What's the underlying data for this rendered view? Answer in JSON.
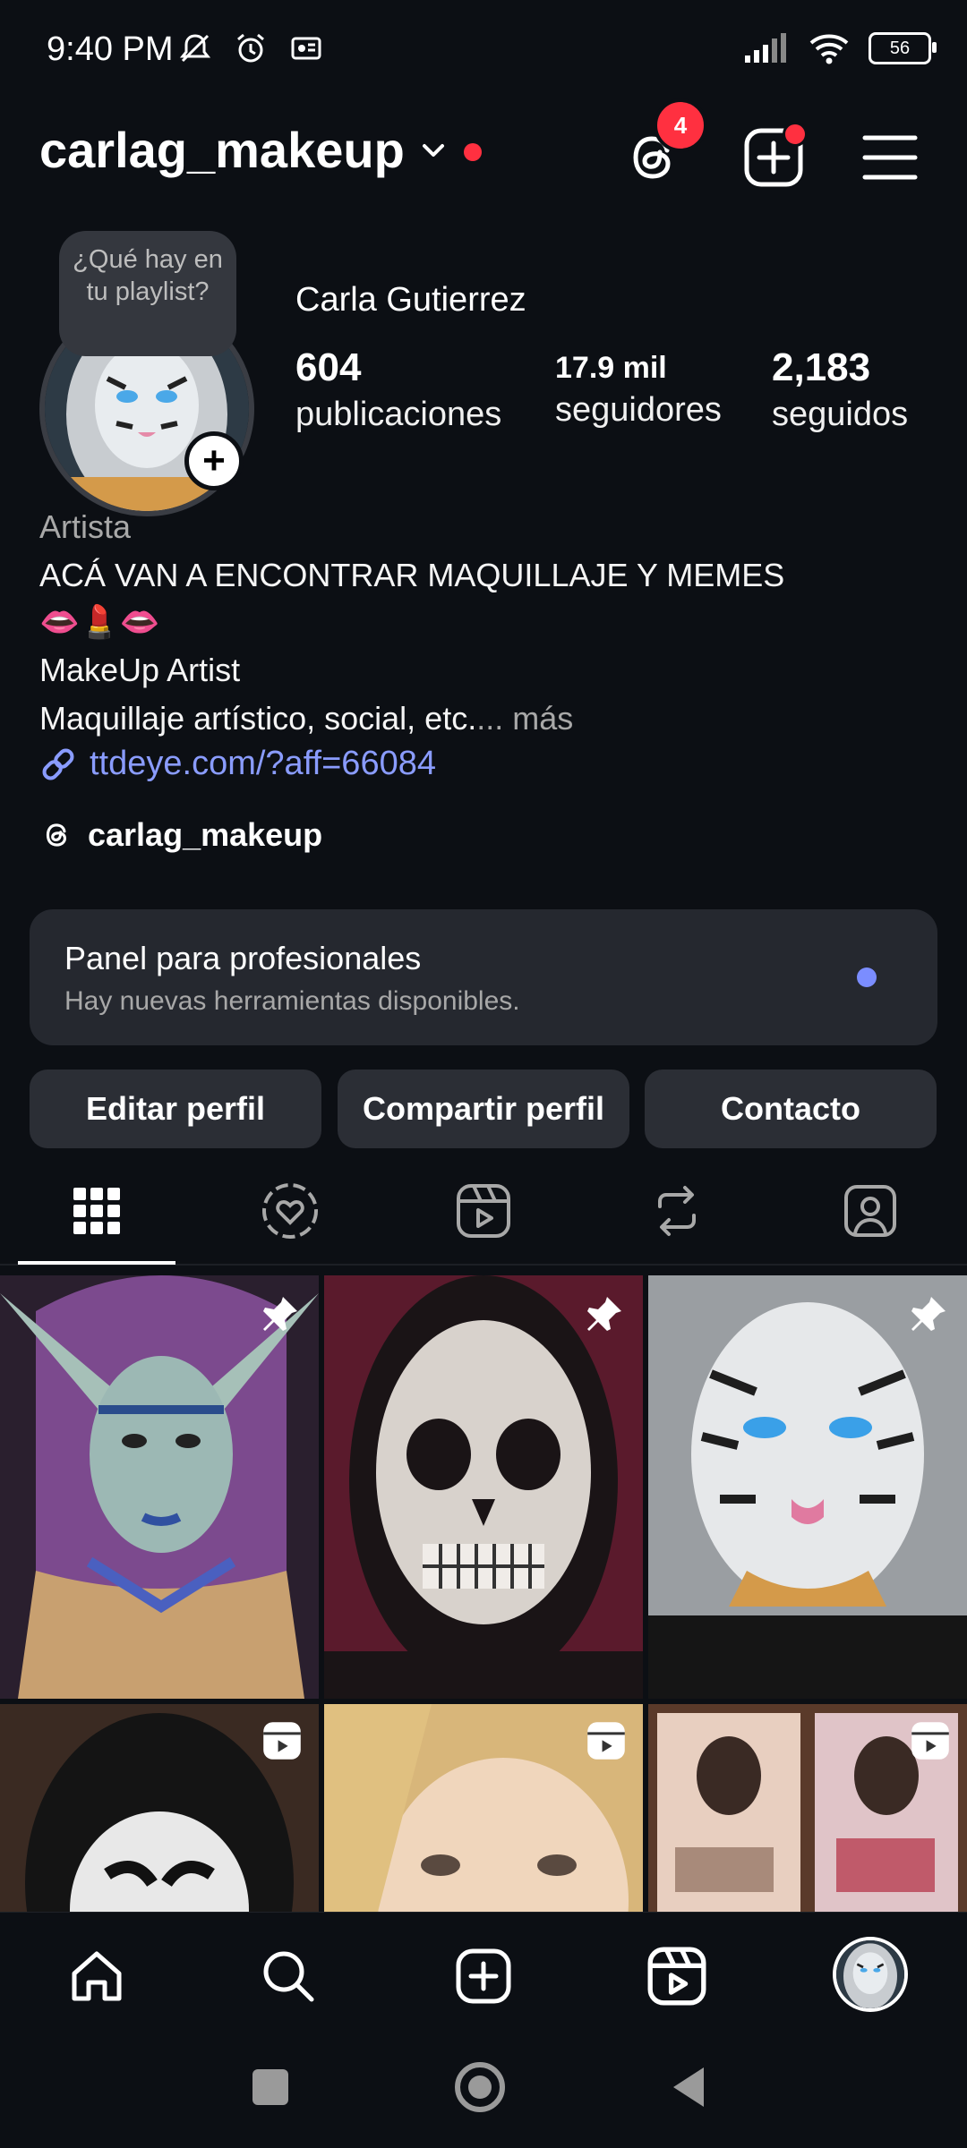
{
  "status_bar": {
    "time": "9:40 PM",
    "icons_left": [
      "mute-icon",
      "alarm-icon",
      "cast-icon"
    ],
    "icons_right": [
      "signal-icon",
      "wifi-icon",
      "battery-icon"
    ],
    "battery": "56"
  },
  "header": {
    "username": "carlag_makeup",
    "threads_badge": "4",
    "icons": [
      "threads-icon",
      "new-post-icon",
      "menu-icon"
    ]
  },
  "profile": {
    "note_bubble": "¿Qué hay en tu playlist?",
    "full_name": "Carla Gutierrez",
    "stats": [
      {
        "value": "604",
        "label": "publicaciones"
      },
      {
        "value": "17.9 mil",
        "label": "seguidores"
      },
      {
        "value": "2,183",
        "label": "seguidos"
      }
    ],
    "category": "Artista",
    "bio_line1": "ACÁ VAN A ENCONTRAR MAQUILLAJE Y MEMES",
    "bio_line2": "👄💄👄",
    "bio_line3": "MakeUp Artist",
    "bio_line4": "Maquillaje artístico, social, etc.",
    "more_label": "... más",
    "link": "ttdeye.com/?aff=66084",
    "threads_handle": "carlag_makeup"
  },
  "pro_panel": {
    "title": "Panel para profesionales",
    "subtitle": "Hay nuevas herramientas disponibles."
  },
  "buttons": {
    "edit": "Editar perfil",
    "share": "Compartir perfil",
    "contact": "Contacto"
  },
  "tabs": [
    "grid-icon",
    "collab-icon",
    "reels-icon",
    "reposts-icon",
    "tagged-icon"
  ],
  "grid": {
    "row1": [
      "elf-makeup-post",
      "skull-makeup-post",
      "tiger-makeup-post"
    ],
    "row2": [
      "dark-mask-reel",
      "blonde-portrait-reel",
      "product-display-reel"
    ],
    "pinned": true
  },
  "bottom_nav": [
    "home-icon",
    "search-icon",
    "create-icon",
    "reels-icon",
    "profile-avatar"
  ],
  "colors": {
    "background": "#0c0f14",
    "accent_link": "#8a9cff",
    "notification_red": "#ff3040",
    "button_bg": "#2b2e35"
  }
}
